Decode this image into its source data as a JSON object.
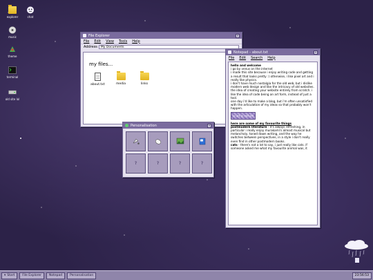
{
  "desktop": {
    "icons": [
      {
        "label": "explorer",
        "icon": "folder-icon"
      },
      {
        "label": "chat",
        "icon": "chat-icon"
      },
      {
        "label": "music",
        "icon": "music-icon"
      },
      {
        "label": "theme",
        "icon": "theme-icon"
      },
      {
        "label": "terminal",
        "icon": "terminal-icon"
      },
      {
        "label": "old site lol",
        "icon": "drive-icon"
      }
    ]
  },
  "file_explorer": {
    "title": "File Explorer",
    "menu": [
      "File",
      "Edit",
      "View",
      "Tools",
      "Help"
    ],
    "address_label": "Address",
    "address_value": "My Documents",
    "heading": "my files...",
    "files": [
      {
        "name": "about.txt",
        "type": "document"
      },
      {
        "name": "media",
        "type": "folder"
      },
      {
        "name": "links",
        "type": "folder"
      }
    ]
  },
  "notepad": {
    "title": "Notepad – about.txt",
    "menu": [
      "File",
      "Edit",
      "Search",
      "Help"
    ],
    "heading": "hello and welcome",
    "intro": "i go by venus on the internet",
    "para1": "i made this site because i enjoy writing code and getting a result that looks pretty :) otherwise, i like pixel art and i really like physics.",
    "para2": "i don't have much nostalgia for the old web, but i dislike modern web design and like the intricacy of old websites. the idea of creating your website entirely from scratch. i like the idea of code being an art form, instead of just a tool.",
    "para3": "one day i'd like to make a blog, but i'm often unsatisfied with the articulation of my ideas so that probably won't happen.",
    "stamp": "ai art is not art",
    "things_heading": "here are some of my favourite things",
    "postmodern_label": "postmodern literature",
    "postmodern_text": "- it's always refreshing, in particular i really enjoy murakami's almost musical but melancholy, toned down writing, and the way he switches between perspectives, in a style i don't really even find in other postmodern books.",
    "cats_label": "cats",
    "cats_text": "- there's not a lot to say, i just really like cats. if someone asked me what my favourite animal was, it"
  },
  "personalisation": {
    "title": "Personalisation",
    "tiles": [
      {
        "label": "",
        "icon": "paint-icon"
      },
      {
        "label": "",
        "icon": "mouse-icon"
      },
      {
        "label": "",
        "icon": "wallpaper-icon"
      },
      {
        "label": "",
        "icon": "book-icon"
      },
      {
        "label": "?",
        "icon": ""
      },
      {
        "label": "?",
        "icon": ""
      },
      {
        "label": "?",
        "icon": ""
      },
      {
        "label": "?",
        "icon": ""
      }
    ]
  },
  "taskbar": {
    "start": "Start",
    "items": [
      "File Explorer",
      "Notepad",
      "Personalisation"
    ],
    "clock": "23:56:53"
  },
  "colors": {
    "titlebar": "#7a6b9e",
    "desktop": "#2c2248",
    "taskbar": "#8f85aa"
  }
}
